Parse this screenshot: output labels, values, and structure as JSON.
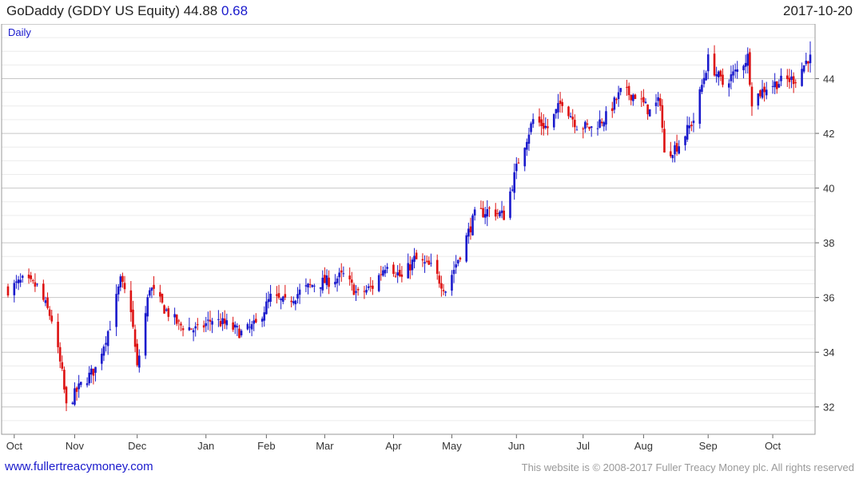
{
  "header": {
    "name": "GoDaddy (GDDY US Equity)",
    "price": "44.88",
    "change": "0.68",
    "date": "2017-10-20"
  },
  "footer": {
    "site": "www.fullertreacymoney.com",
    "copyright": "This website is © 2008-2017 Fuller Treacy Money plc. All rights reserved"
  },
  "colors": {
    "up": "#1a1acc",
    "down": "#dd1111",
    "grid": "#cccccc"
  },
  "chart_data": {
    "type": "candlestick",
    "period_label": "Daily",
    "ylim": [
      31,
      46
    ],
    "yticks": [
      32,
      34,
      36,
      38,
      40,
      42,
      44
    ],
    "xticks": [
      {
        "label": "Oct",
        "date": "2016-10-03"
      },
      {
        "label": "Nov",
        "date": "2016-11-01"
      },
      {
        "label": "Dec",
        "date": "2016-12-01"
      },
      {
        "label": "Jan",
        "date": "2017-01-03"
      },
      {
        "label": "Feb",
        "date": "2017-02-01"
      },
      {
        "label": "Mar",
        "date": "2017-03-01"
      },
      {
        "label": "Apr",
        "date": "2017-04-03"
      },
      {
        "label": "May",
        "date": "2017-05-01"
      },
      {
        "label": "Jun",
        "date": "2017-06-01"
      },
      {
        "label": "Jul",
        "date": "2017-07-03"
      },
      {
        "label": "Aug",
        "date": "2017-08-01"
      },
      {
        "label": "Sep",
        "date": "2017-09-01"
      },
      {
        "label": "Oct",
        "date": "2017-10-02"
      }
    ],
    "closes": [
      [
        "2016-09-30",
        36.3
      ],
      [
        "2016-10-07",
        36.6
      ],
      [
        "2016-10-14",
        36.4
      ],
      [
        "2016-10-21",
        35.2
      ],
      [
        "2016-10-26",
        33.2
      ],
      [
        "2016-10-28",
        32.0
      ],
      [
        "2016-11-04",
        32.8
      ],
      [
        "2016-11-11",
        33.4
      ],
      [
        "2016-11-18",
        35.0
      ],
      [
        "2016-11-23",
        36.6
      ],
      [
        "2016-11-28",
        35.6
      ],
      [
        "2016-12-01",
        33.4
      ],
      [
        "2016-12-07",
        36.4
      ],
      [
        "2016-12-14",
        35.6
      ],
      [
        "2016-12-21",
        35.0
      ],
      [
        "2016-12-30",
        34.8
      ],
      [
        "2017-01-06",
        35.2
      ],
      [
        "2017-01-13",
        35.0
      ],
      [
        "2017-01-20",
        34.7
      ],
      [
        "2017-01-27",
        35.0
      ],
      [
        "2017-02-03",
        36.0
      ],
      [
        "2017-02-10",
        35.8
      ],
      [
        "2017-02-17",
        36.2
      ],
      [
        "2017-02-24",
        36.5
      ],
      [
        "2017-03-03",
        36.6
      ],
      [
        "2017-03-10",
        36.8
      ],
      [
        "2017-03-17",
        36.1
      ],
      [
        "2017-03-24",
        36.4
      ],
      [
        "2017-03-31",
        37.3
      ],
      [
        "2017-04-07",
        36.7
      ],
      [
        "2017-04-13",
        37.4
      ],
      [
        "2017-04-21",
        37.1
      ],
      [
        "2017-04-28",
        36.3
      ],
      [
        "2017-05-05",
        37.6
      ],
      [
        "2017-05-12",
        39.0
      ],
      [
        "2017-05-19",
        39.2
      ],
      [
        "2017-05-26",
        39.0
      ],
      [
        "2017-06-02",
        41.0
      ],
      [
        "2017-06-09",
        42.5
      ],
      [
        "2017-06-16",
        42.2
      ],
      [
        "2017-06-23",
        43.2
      ],
      [
        "2017-06-30",
        42.3
      ],
      [
        "2017-07-07",
        42.2
      ],
      [
        "2017-07-14",
        42.6
      ],
      [
        "2017-07-21",
        43.5
      ],
      [
        "2017-07-28",
        43.4
      ],
      [
        "2017-08-04",
        42.8
      ],
      [
        "2017-08-09",
        43.2
      ],
      [
        "2017-08-11",
        41.2
      ],
      [
        "2017-08-18",
        41.6
      ],
      [
        "2017-08-25",
        42.5
      ],
      [
        "2017-09-01",
        44.7
      ],
      [
        "2017-09-08",
        43.8
      ],
      [
        "2017-09-15",
        44.3
      ],
      [
        "2017-09-20",
        44.8
      ],
      [
        "2017-09-22",
        43.2
      ],
      [
        "2017-09-29",
        43.7
      ],
      [
        "2017-10-06",
        43.9
      ],
      [
        "2017-10-13",
        44.0
      ],
      [
        "2017-10-20",
        44.88
      ]
    ]
  }
}
